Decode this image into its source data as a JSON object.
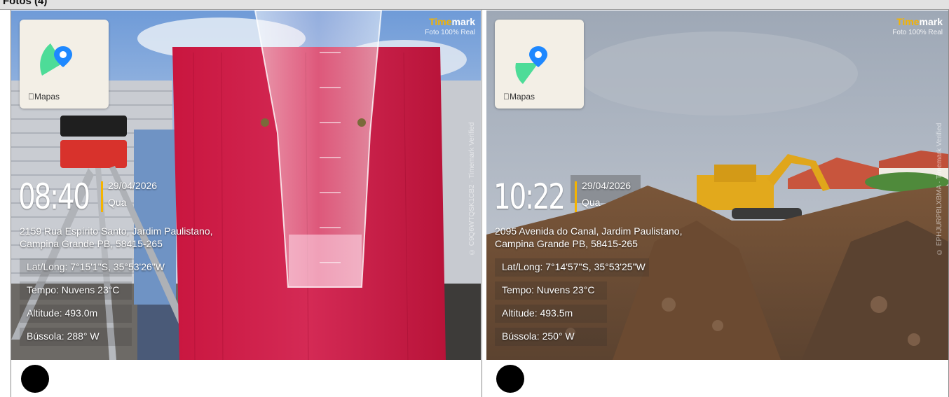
{
  "header": {
    "title": "Fotos (4)"
  },
  "photos": [
    {
      "brand": {
        "name_part1": "Time",
        "name_part2": "mark",
        "tagline": "Foto 100% Real"
      },
      "map": {
        "label": "Mapas"
      },
      "side_code": "© C9Q6WTQSK1CB2 · Timemark Verified",
      "time": "08:40",
      "date": "29/04/2026",
      "weekday": "Qua",
      "address_line1": "2159 Rua Espírito Santo, Jardim Paulistano,",
      "address_line2": "Campina Grande PB, 58415-265",
      "latlong": "Lat/Long: 7°15'1\"S, 35°53'26\"W",
      "weather": "Tempo: Nuvens 23°C",
      "altitude": "Altitude: 493.0m",
      "compass": "Bússola: 288° W"
    },
    {
      "brand": {
        "name_part1": "Time",
        "name_part2": "mark",
        "tagline": "Foto 100% Real"
      },
      "map": {
        "label": "Mapas"
      },
      "side_code": "© EPHJURPBLXBMA · Timemark Verified",
      "time": "10:22",
      "date": "29/04/2026",
      "weekday": "Qua",
      "address_line1": "2095 Avenida do Canal, Jardim Paulistano,",
      "address_line2": "Campina Grande PB, 58415-265",
      "latlong": "Lat/Long: 7°14'57\"S, 35°53'25\"W",
      "weather": "Tempo: Nuvens 23°C",
      "altitude": "Altitude: 493.5m",
      "compass": "Bússola: 250° W"
    }
  ],
  "colors": {
    "brand_accent": "#f5b400",
    "pin": "#1e88ff",
    "cone": "#2fd88a"
  }
}
